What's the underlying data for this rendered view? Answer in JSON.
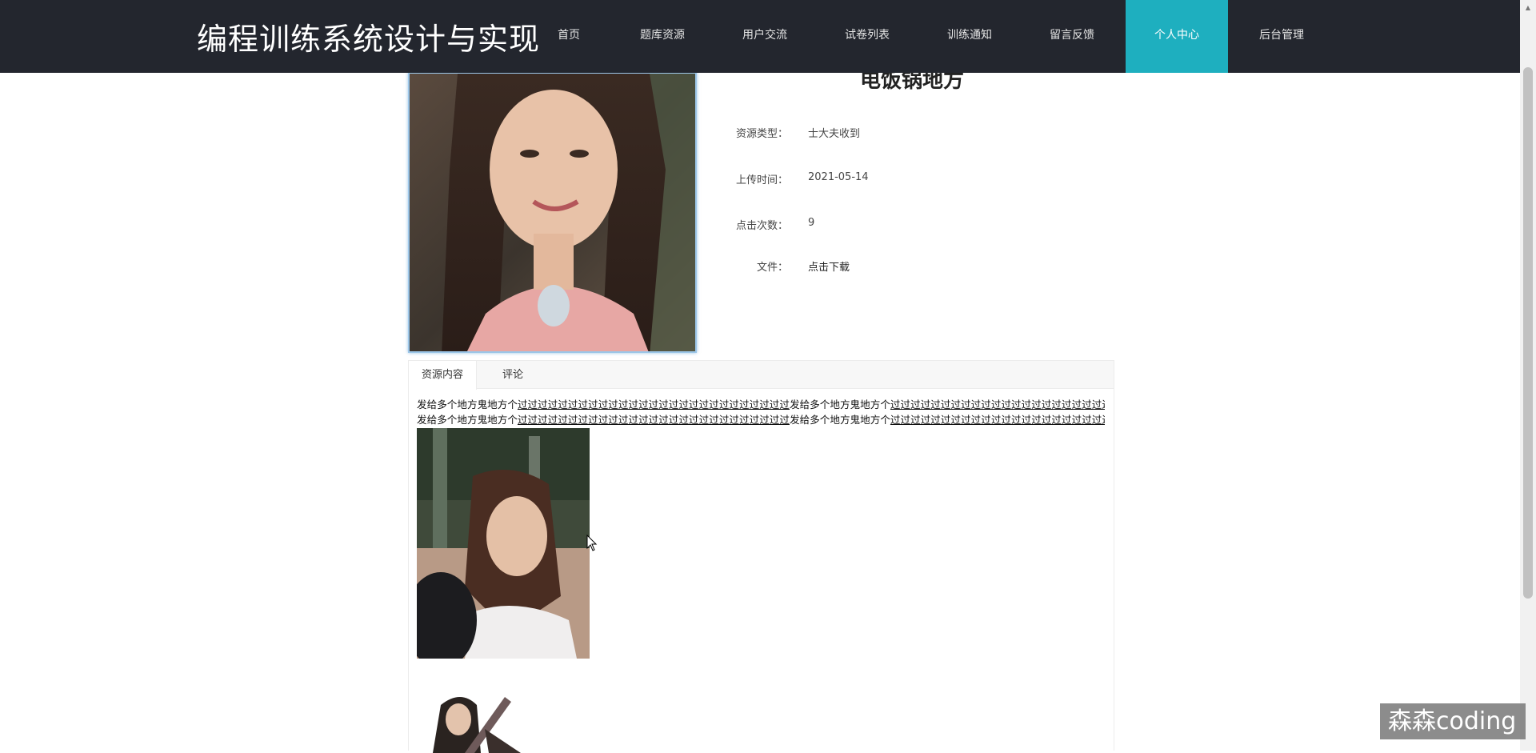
{
  "header": {
    "site_title": "编程训练系统设计与实现",
    "nav": [
      {
        "label": "首页",
        "active": false
      },
      {
        "label": "题库资源",
        "active": false
      },
      {
        "label": "用户交流",
        "active": false
      },
      {
        "label": "试卷列表",
        "active": false
      },
      {
        "label": "训练通知",
        "active": false
      },
      {
        "label": "留言反馈",
        "active": false
      },
      {
        "label": "个人中心",
        "active": true
      },
      {
        "label": "后台管理",
        "active": false
      }
    ]
  },
  "resource": {
    "title": "电饭锅地方",
    "type_label": "资源类型：",
    "type_value": "士大夫收到",
    "upload_label": "上传时间：",
    "upload_value": "2021-05-14",
    "clicks_label": "点击次数：",
    "clicks_value": "9",
    "file_label": "文件：",
    "file_link": "点击下载"
  },
  "tabs": [
    {
      "label": "资源内容",
      "active": true
    },
    {
      "label": "评论",
      "active": false
    }
  ],
  "content": {
    "line1_a": "发给多个地方鬼地方个",
    "line1_b": "过过过过过过过过过过过过过过过过过过过过过过过过过过过",
    "line1_c": "发给多个地方鬼地方个",
    "line1_d": "过过过过过过过过过过过过过过过过过过过过过过过过过过过过过过过",
    "line2_a": "发给多个地方鬼地方个",
    "line2_b": "过过过过过过过过过过过过过过过过过过过过过过过过过过过",
    "line2_c": "发给多个地方鬼地方个",
    "line2_d": "过过过过过过过过过过过过过过过过过过过过过过过过过过过过过过过"
  },
  "watermark": "森森coding"
}
